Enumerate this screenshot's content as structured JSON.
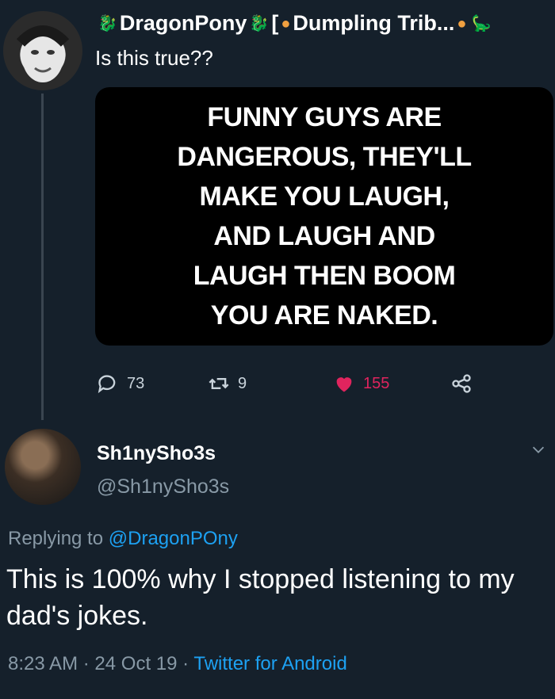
{
  "tweet1": {
    "display_name": "DragonPony",
    "group_tag": "[",
    "group_name": "Dumpling Trib...",
    "text": "Is this true??",
    "image_lines": [
      "FUNNY GUYS ARE",
      "DANGEROUS, THEY'LL",
      "MAKE YOU LAUGH,",
      "AND LAUGH AND",
      "LAUGH THEN BOOM",
      "YOU ARE NAKED."
    ],
    "reply_count": "73",
    "retweet_count": "9",
    "like_count": "155"
  },
  "tweet2": {
    "display_name": "Sh1nySho3s",
    "handle": "@Sh1nySho3s",
    "replying_label": "Replying to",
    "replying_to": "@DragonPOny",
    "text": "This is 100% why I stopped listening to my dad's jokes.",
    "time": "8:23 AM",
    "date": "24 Oct 19",
    "sep": "·",
    "source": "Twitter for Android"
  },
  "colors": {
    "background": "#15202b",
    "like": "#e0245e",
    "link": "#1da1f2",
    "muted": "#8899a6"
  },
  "icons": [
    "dragon-icon",
    "dumpling-icon",
    "reply-icon",
    "retweet-icon",
    "heart-icon",
    "share-icon",
    "chevron-down-icon"
  ]
}
